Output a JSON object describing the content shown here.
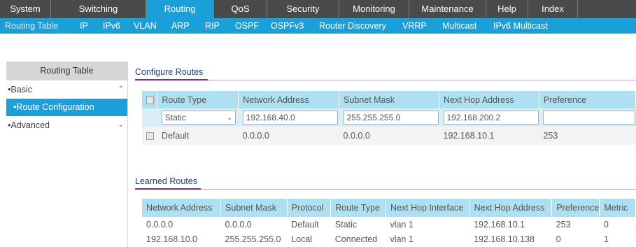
{
  "top_nav": [
    "System",
    "Switching",
    "Routing",
    "QoS",
    "Security",
    "Monitoring",
    "Maintenance",
    "Help",
    "Index"
  ],
  "sub_nav": [
    "Routing Table",
    "IP",
    "IPv6",
    "VLAN",
    "ARP",
    "RIP",
    "OSPF",
    "OSPFv3",
    "Router Discovery",
    "VRRP",
    "Multicast",
    "IPv6 Multicast"
  ],
  "sidebar": {
    "title": "Routing Table",
    "basic": "Basic",
    "route_config": "Route Configuration",
    "advanced": "Advanced"
  },
  "configure": {
    "title": "Configure Routes",
    "headers": [
      "Route Type",
      "Network Address",
      "Subnet Mask",
      "Next Hop Address",
      "Preference"
    ],
    "edit_row": {
      "route_type": "Static",
      "network": "192.168.40.0",
      "mask": "255.255.255.0",
      "next_hop": "192.168.200.2",
      "preference": ""
    },
    "default_row": [
      "Default",
      "0.0.0.0",
      "0.0.0.0",
      "192.168.10.1",
      "253"
    ]
  },
  "learned": {
    "title": "Learned Routes",
    "headers": [
      "Network Address",
      "Subnet Mask",
      "Protocol",
      "Route Type",
      "Next Hop Interface",
      "Next Hop Address",
      "Preference",
      "Metric"
    ],
    "rows": [
      [
        "0.0.0.0",
        "0.0.0.0",
        "Default",
        "Static",
        "vlan 1",
        "192.168.10.1",
        "253",
        "0"
      ],
      [
        "192.168.10.0",
        "255.255.255.0",
        "Local",
        "Connected",
        "vlan 1",
        "192.168.10.138",
        "0",
        "1"
      ]
    ]
  },
  "colors": {
    "nav_bg": "#4a4a4a",
    "accent": "#1a9fd9",
    "header_bg": "#aee0f3",
    "section_line": "#7a2c8f"
  }
}
